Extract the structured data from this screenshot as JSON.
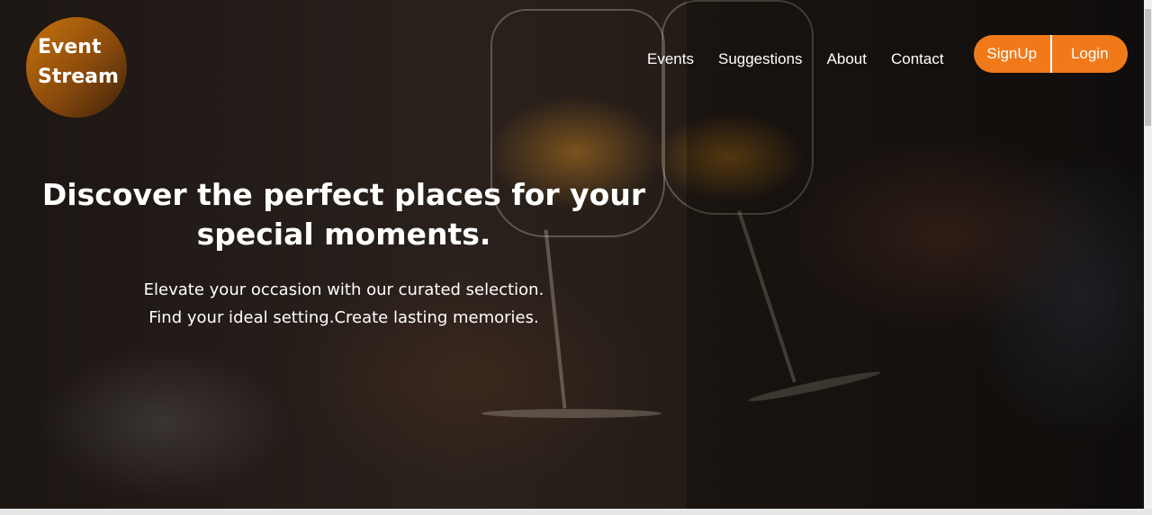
{
  "brand": {
    "logo_line1": "Event",
    "logo_line2": "Stream"
  },
  "nav": {
    "items": [
      {
        "label": "Events"
      },
      {
        "label": "Suggestions"
      },
      {
        "label": "About"
      },
      {
        "label": "Contact"
      }
    ]
  },
  "auth": {
    "signup_label": "SignUp",
    "login_label": "Login"
  },
  "hero": {
    "headline_line1": "Discover the perfect places for your",
    "headline_line2": "special moments.",
    "subline1": "Elevate your occasion with our curated selection.",
    "subline2": "Find your ideal setting.Create lasting memories."
  },
  "colors": {
    "accent": "#f07a1a",
    "logo_gradient_start": "#c8740c",
    "logo_gradient_end": "#3a2208"
  }
}
